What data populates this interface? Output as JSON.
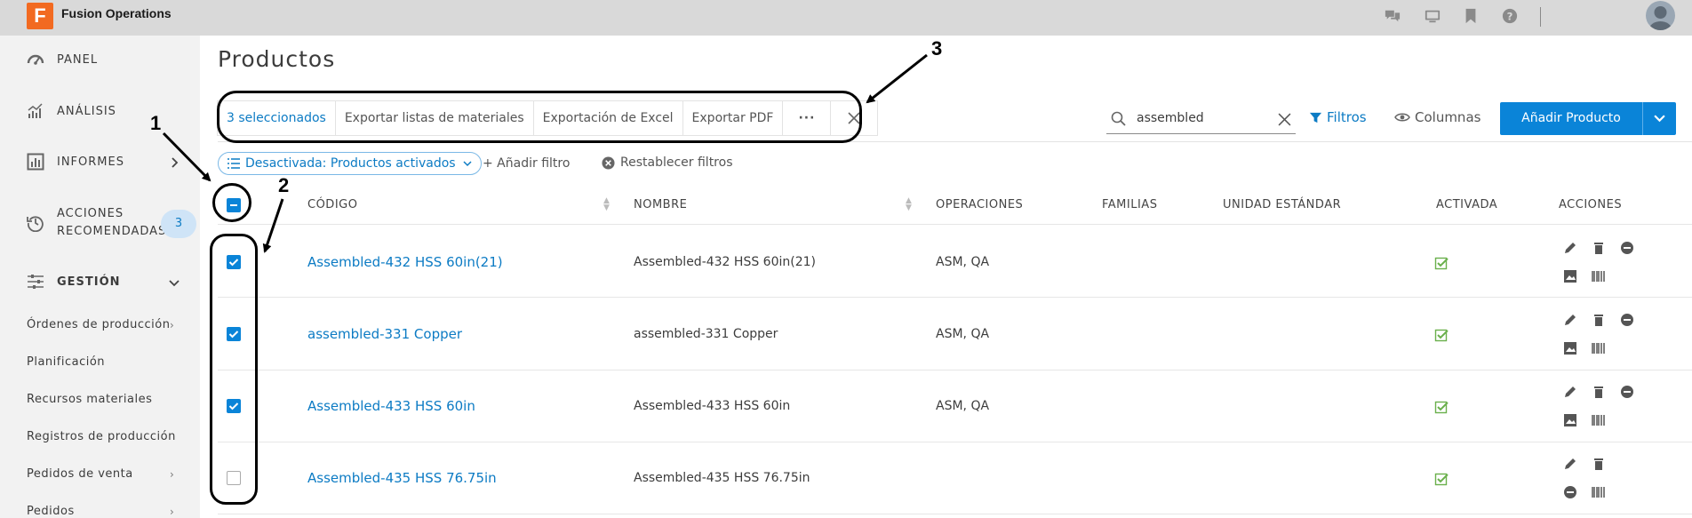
{
  "app": {
    "logo_letter": "F",
    "title": "Fusion Operations"
  },
  "topbar": {
    "icons": [
      "chat-icon",
      "monitor-icon",
      "bookmark-icon",
      "help-icon"
    ],
    "avatar": "user-avatar"
  },
  "sidebar": {
    "items": [
      {
        "label": "PANEL",
        "icon": "gauge-icon"
      },
      {
        "label": "ANÁLISIS",
        "icon": "chart-icon"
      },
      {
        "label": "INFORMES",
        "icon": "report-icon"
      },
      {
        "label": "ACCIONES",
        "label2": "RECOMENDADAS",
        "icon": "history-icon",
        "badge": "3"
      },
      {
        "label": "GESTIÓN",
        "icon": "sliders-icon"
      }
    ],
    "sub_items": [
      {
        "label": "Órdenes de producción"
      },
      {
        "label": "Planificación"
      },
      {
        "label": "Recursos materiales"
      },
      {
        "label": "Registros de producción"
      },
      {
        "label": "Pedidos de venta"
      },
      {
        "label": "Pedidos"
      }
    ]
  },
  "page": {
    "title": "Productos"
  },
  "actionbar": {
    "selected": "3 seleccionados",
    "items": [
      "Exportar listas de materiales",
      "Exportación de Excel",
      "Exportar PDF"
    ],
    "more": "···"
  },
  "search": {
    "value": "assembled"
  },
  "toolbar": {
    "filters": "Filtros",
    "columns": "Columnas",
    "add_product": "Añadir Producto"
  },
  "filters": {
    "chip": "Desactivada: Productos activados",
    "add": "+ Añadir filtro",
    "reset": "Restablecer filtros"
  },
  "table": {
    "headers": [
      "CÓDIGO",
      "NOMBRE",
      "OPERACIONES",
      "FAMILIAS",
      "UNIDAD ESTÁNDAR",
      "ACTIVADA",
      "ACCIONES"
    ],
    "rows": [
      {
        "code": "Assembled-432 HSS 60in(21)",
        "name": "Assembled-432 HSS 60in(21)",
        "operations": "ASM, QA",
        "checked": true
      },
      {
        "code": "assembled-331 Copper",
        "name": "assembled-331 Copper",
        "operations": "ASM, QA",
        "checked": true
      },
      {
        "code": "Assembled-433 HSS 60in",
        "name": "Assembled-433 HSS 60in",
        "operations": "ASM, QA",
        "checked": true
      },
      {
        "code": "Assembled-435 HSS 76.75in",
        "name": "Assembled-435 HSS 76.75in",
        "operations": "",
        "checked": false
      }
    ]
  },
  "annotations": {
    "n1": "1",
    "n2": "2",
    "n3": "3"
  },
  "colors": {
    "accent": "#0a84d8",
    "logo": "#f26a21",
    "active_check": "#6ab04c"
  }
}
